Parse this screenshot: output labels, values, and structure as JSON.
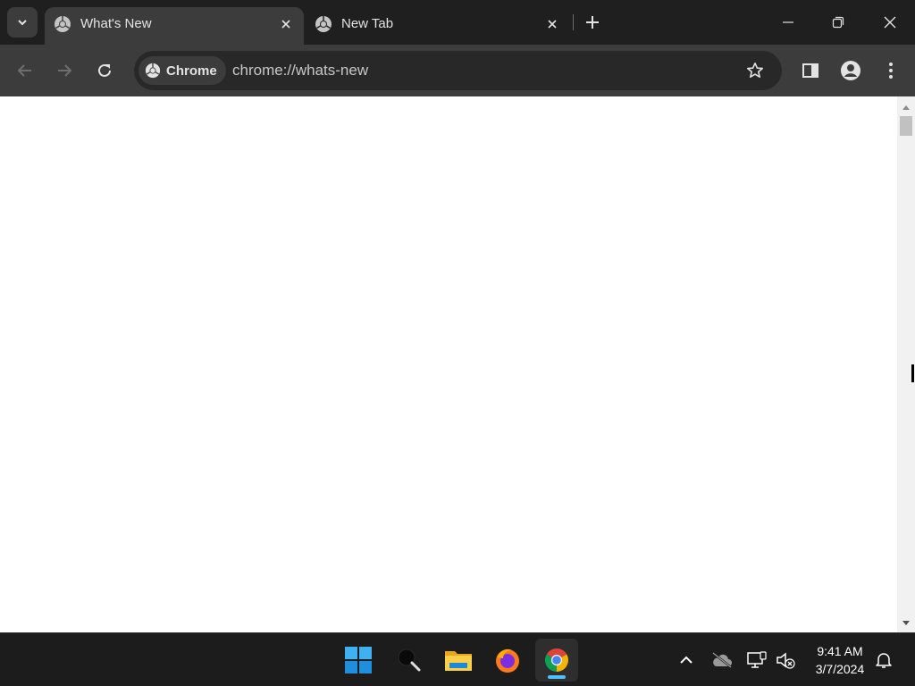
{
  "browser": {
    "tabs": [
      {
        "title": "What's New",
        "active": true
      },
      {
        "title": "New Tab",
        "active": false
      }
    ],
    "omnibox": {
      "chip_label": "Chrome",
      "url": "chrome://whats-new"
    }
  },
  "taskbar": {
    "apps": [
      "windows-start",
      "search",
      "file-explorer",
      "firefox",
      "chrome"
    ],
    "active_app": "chrome"
  },
  "clock": {
    "time": "9:41 AM",
    "date": "3/7/2024"
  },
  "colors": {
    "tab_bar": "#1f1f1f",
    "toolbar": "#3c3c3c",
    "omnibox": "#282828",
    "content": "#ffffff",
    "taskbar": "#1c1c1c",
    "accent": "#4cc2ff"
  }
}
